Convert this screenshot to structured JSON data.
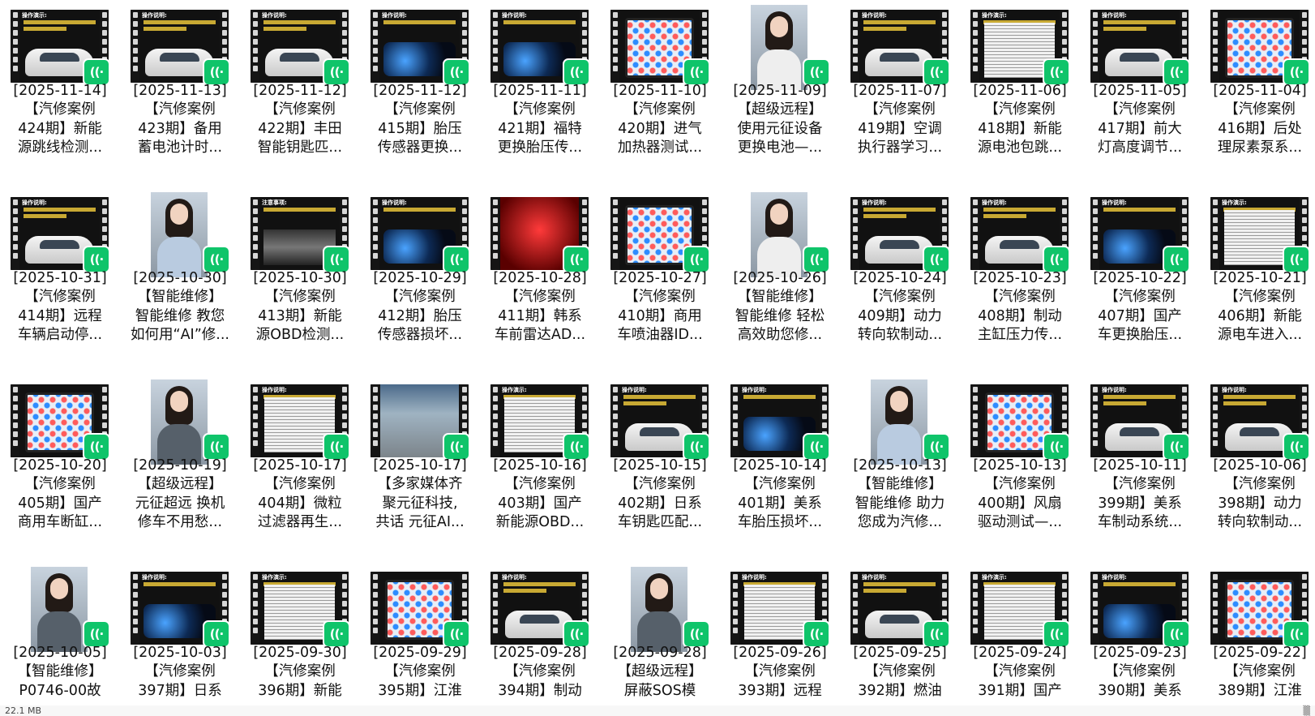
{
  "items": [
    {
      "kind": "car",
      "top": "操作演示:",
      "caption": "[2025-11-14]\n【汽修案例\n424期】新能\n源跳线检测..."
    },
    {
      "kind": "car",
      "top": "操作说明:",
      "caption": "[2025-11-13]\n【汽修案例\n423期】备用\n蓄电池计时..."
    },
    {
      "kind": "car",
      "top": "操作说明:",
      "caption": "[2025-11-12]\n【汽修案例\n422期】丰田\n智能钥匙匹..."
    },
    {
      "kind": "dash",
      "top": "操作说明:",
      "caption": "[2025-11-12]\n【汽修案例\n415期】胎压\n传感器更换..."
    },
    {
      "kind": "dash",
      "top": "操作说明:",
      "caption": "[2025-11-11]\n【汽修案例\n421期】福特\n更换胎压传..."
    },
    {
      "kind": "tablet",
      "top": "",
      "caption": "[2025-11-10]\n【汽修案例\n420期】进气\n加热器测试..."
    },
    {
      "kind": "person",
      "body": "",
      "caption": "[2025-11-09]\n【超级远程】\n使用元征设备\n更换电池—..."
    },
    {
      "kind": "car",
      "top": "操作说明:",
      "caption": "[2025-11-07]\n【汽修案例\n419期】空调\n执行器学习..."
    },
    {
      "kind": "doc",
      "top": "操作演示:",
      "caption": "[2025-11-06]\n【汽修案例\n418期】新能\n源电池包跳..."
    },
    {
      "kind": "car",
      "top": "操作说明:",
      "caption": "[2025-11-05]\n【汽修案例\n417期】前大\n灯高度调节..."
    },
    {
      "kind": "tablet",
      "top": "",
      "caption": "[2025-11-04]\n【汽修案例\n416期】后处\n理尿素泵系..."
    },
    {
      "kind": "car",
      "top": "操作说明:",
      "caption": "[2025-10-31]\n【汽修案例\n414期】远程\n车辆启动停..."
    },
    {
      "kind": "person",
      "body": "blue",
      "caption": "[2025-10-30]\n【智能维修】\n智能维修 教您\n如何用“AI”修..."
    },
    {
      "kind": "engine",
      "top": "注意事项:",
      "caption": "[2025-10-30]\n【汽修案例\n413期】新能\n源OBD检测..."
    },
    {
      "kind": "dash",
      "top": "操作说明:",
      "caption": "[2025-10-29]\n【汽修案例\n412期】胎压\n传感器损坏..."
    },
    {
      "kind": "red",
      "top": "",
      "caption": "[2025-10-28]\n【汽修案例\n411期】韩系\n车前雷达AD..."
    },
    {
      "kind": "tablet",
      "top": "",
      "caption": "[2025-10-27]\n【汽修案例\n410期】商用\n车喷油器ID..."
    },
    {
      "kind": "person",
      "body": "",
      "caption": "[2025-10-26]\n【智能维修】\n智能维修 轻松\n高效助您修..."
    },
    {
      "kind": "car",
      "top": "操作说明:",
      "caption": "[2025-10-24]\n【汽修案例\n409期】动力\n转向软制动..."
    },
    {
      "kind": "car",
      "top": "操作说明:",
      "caption": "[2025-10-23]\n【汽修案例\n408期】制动\n主缸压力传..."
    },
    {
      "kind": "dash",
      "top": "操作说明:",
      "caption": "[2025-10-22]\n【汽修案例\n407期】国产\n车更换胎压..."
    },
    {
      "kind": "doc",
      "top": "操作演示:",
      "caption": "[2025-10-21]\n【汽修案例\n406期】新能\n源电车进入..."
    },
    {
      "kind": "tablet",
      "top": "",
      "caption": "[2025-10-20]\n【汽修案例\n405期】国产\n商用车断缸..."
    },
    {
      "kind": "person",
      "body": "dark",
      "caption": "[2025-10-19]\n【超级远程】\n元征超远 换机\n修车不用愁..."
    },
    {
      "kind": "doc",
      "top": "操作说明:",
      "caption": "[2025-10-17]\n【汽修案例\n404期】微粒\n过滤器再生..."
    },
    {
      "kind": "shop",
      "top": "",
      "caption": "[2025-10-17]\n【多家媒体齐\n聚元征科技,\n共话 元征AI..."
    },
    {
      "kind": "doc",
      "top": "操作演示:",
      "caption": "[2025-10-16]\n【汽修案例\n403期】国产\n新能源OBD..."
    },
    {
      "kind": "car",
      "top": "操作说明:",
      "caption": "[2025-10-15]\n【汽修案例\n402期】日系\n车钥匙匹配..."
    },
    {
      "kind": "dash",
      "top": "操作说明:",
      "caption": "[2025-10-14]\n【汽修案例\n401期】美系\n车胎压损坏..."
    },
    {
      "kind": "person",
      "body": "blue",
      "caption": "[2025-10-13]\n【智能维修】\n智能维修 助力\n您成为汽修..."
    },
    {
      "kind": "tablet",
      "top": "",
      "caption": "[2025-10-13]\n【汽修案例\n400期】风扇\n驱动测试—..."
    },
    {
      "kind": "car",
      "top": "操作说明:",
      "caption": "[2025-10-11]\n【汽修案例\n399期】美系\n车制动系统..."
    },
    {
      "kind": "car",
      "top": "操作说明:",
      "caption": "[2025-10-06]\n【汽修案例\n398期】动力\n转向软制动..."
    },
    {
      "kind": "person",
      "body": "dark",
      "caption": "[2025-10-05]\n【智能维修】\nP0746-00故"
    },
    {
      "kind": "dash",
      "top": "操作说明:",
      "caption": "[2025-10-03]\n【汽修案例\n397期】日系"
    },
    {
      "kind": "doc",
      "top": "操作演示:",
      "caption": "[2025-09-30]\n【汽修案例\n396期】新能"
    },
    {
      "kind": "tablet",
      "top": "",
      "caption": "[2025-09-29]\n【汽修案例\n395期】江淮"
    },
    {
      "kind": "car",
      "top": "操作说明:",
      "caption": "[2025-09-28]\n【汽修案例\n394期】制动"
    },
    {
      "kind": "person",
      "body": "dark",
      "caption": "[2025-09-28]\n【超级远程】\n屏蔽SOS模"
    },
    {
      "kind": "doc",
      "top": "操作说明:",
      "caption": "[2025-09-26]\n【汽修案例\n393期】远程"
    },
    {
      "kind": "car",
      "top": "操作说明:",
      "caption": "[2025-09-25]\n【汽修案例\n392期】燃油"
    },
    {
      "kind": "doc",
      "top": "操作演示:",
      "caption": "[2025-09-24]\n【汽修案例\n391期】国产"
    },
    {
      "kind": "dash",
      "top": "操作说明:",
      "caption": "[2025-09-23]\n【汽修案例\n390期】美系"
    },
    {
      "kind": "tablet",
      "top": "",
      "caption": "[2025-09-22]\n【汽修案例\n389期】江淮"
    }
  ],
  "badge_glyph": "((·",
  "status": {
    "size": "22.1 MB",
    "mark": "▒"
  }
}
